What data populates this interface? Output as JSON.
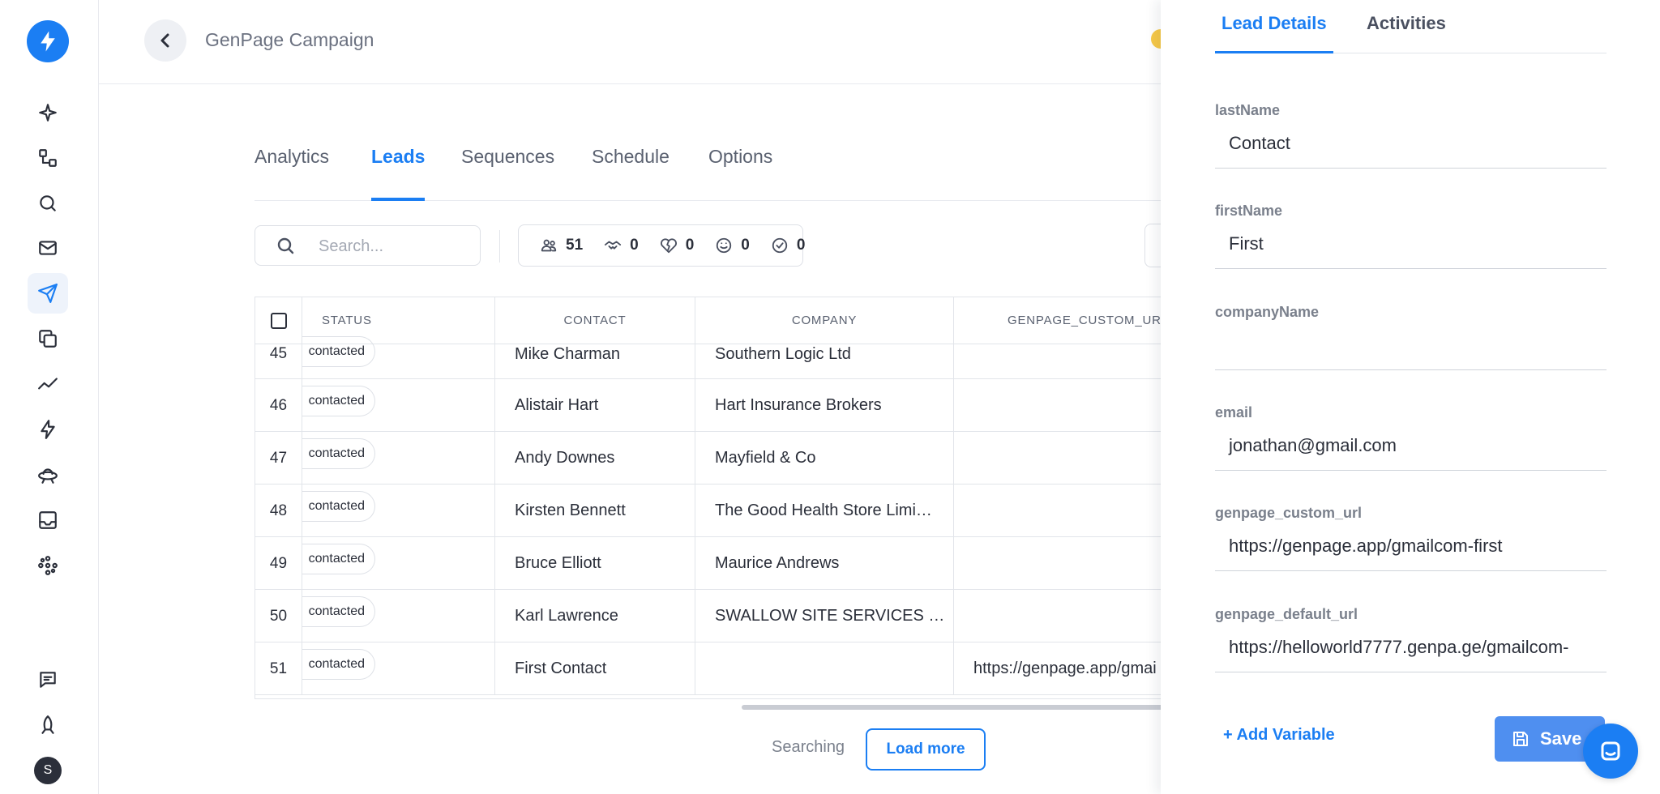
{
  "header": {
    "title": "GenPage Campaign"
  },
  "tabs": [
    {
      "label": "Analytics"
    },
    {
      "label": "Leads"
    },
    {
      "label": "Sequences"
    },
    {
      "label": "Schedule"
    },
    {
      "label": "Options"
    }
  ],
  "toolbar": {
    "search_placeholder": "Search...",
    "stats": [
      "51",
      "0",
      "0",
      "0",
      "0"
    ]
  },
  "table": {
    "columns": [
      "STATUS",
      "CONTACT",
      "COMPANY",
      "GENPAGE_CUSTOM_URL"
    ],
    "rows": [
      {
        "num": "45",
        "status": "contacted",
        "contact": "Mike Charman",
        "company": "Southern Logic Ltd",
        "url": ""
      },
      {
        "num": "46",
        "status": "contacted",
        "contact": "Alistair Hart",
        "company": "Hart Insurance Brokers",
        "url": ""
      },
      {
        "num": "47",
        "status": "contacted",
        "contact": "Andy Downes",
        "company": "Mayfield & Co",
        "url": ""
      },
      {
        "num": "48",
        "status": "contacted",
        "contact": "Kirsten Bennett",
        "company": "The Good Health Store Limi…",
        "url": ""
      },
      {
        "num": "49",
        "status": "contacted",
        "contact": "Bruce Elliott",
        "company": "Maurice Andrews",
        "url": ""
      },
      {
        "num": "50",
        "status": "contacted",
        "contact": "Karl Lawrence",
        "company": "SWALLOW SITE SERVICES …",
        "url": ""
      },
      {
        "num": "51",
        "status": "contacted",
        "contact": "First Contact",
        "company": "",
        "url": "https://genpage.app/gmai"
      }
    ]
  },
  "footer": {
    "searching": "Searching",
    "load_more": "Load more"
  },
  "panel": {
    "tabs": [
      "Lead Details",
      "Activities"
    ],
    "fields": [
      {
        "label": "lastName",
        "value": "Contact"
      },
      {
        "label": "firstName",
        "value": "First"
      },
      {
        "label": "companyName",
        "value": ""
      },
      {
        "label": "email",
        "value": "jonathan@gmail.com"
      },
      {
        "label": "genpage_custom_url",
        "value": "https://genpage.app/gmailcom-first"
      },
      {
        "label": "genpage_default_url",
        "value": "https://helloworld7777.genpa.ge/gmailcom-"
      }
    ],
    "add_variable": "+ Add Variable",
    "save": "Save"
  },
  "user": {
    "initial": "S"
  },
  "colors": {
    "accent": "#1b7ef3",
    "save": "#4f8ff0"
  }
}
